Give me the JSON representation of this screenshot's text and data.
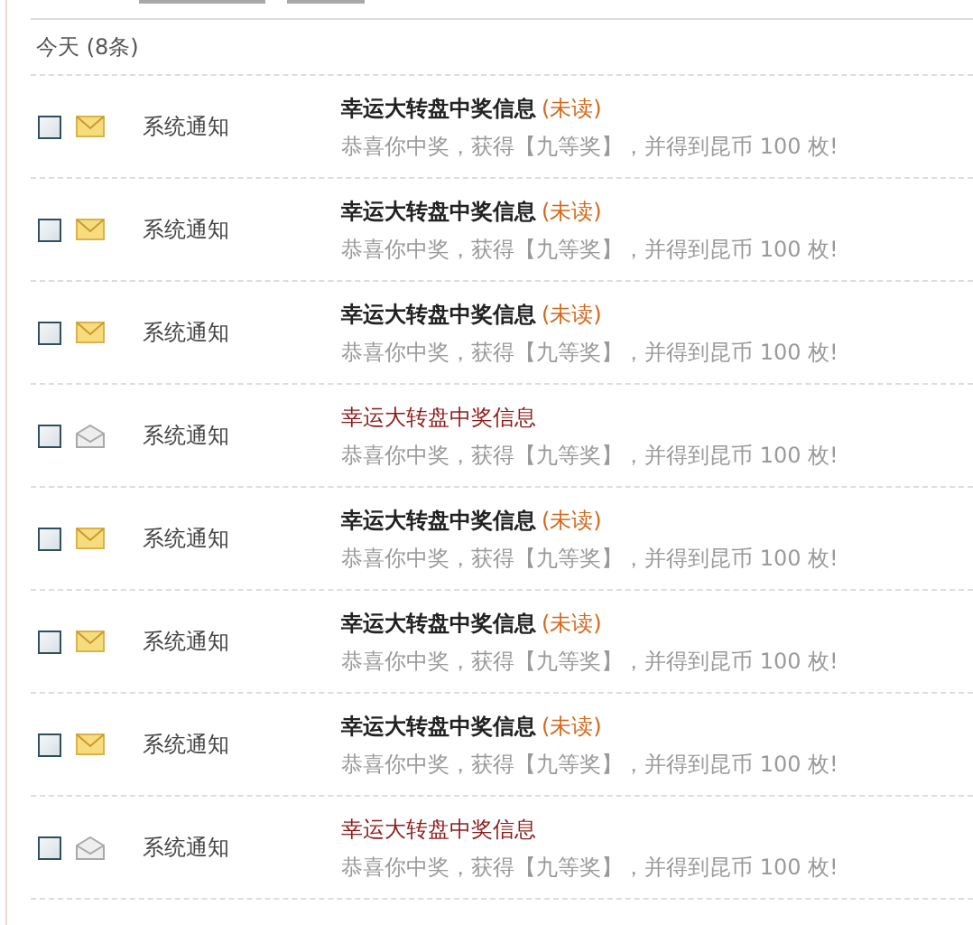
{
  "section": {
    "title": "今天 (8条)"
  },
  "messages": [
    {
      "checked": false,
      "unread": true,
      "sender": "系统通知",
      "title": "幸运大转盘中奖信息",
      "badge": "(未读)",
      "body": "恭喜你中奖，获得【九等奖】，并得到昆币 100 枚!"
    },
    {
      "checked": false,
      "unread": true,
      "sender": "系统通知",
      "title": "幸运大转盘中奖信息",
      "badge": "(未读)",
      "body": "恭喜你中奖，获得【九等奖】，并得到昆币 100 枚!"
    },
    {
      "checked": false,
      "unread": true,
      "sender": "系统通知",
      "title": "幸运大转盘中奖信息",
      "badge": "(未读)",
      "body": "恭喜你中奖，获得【九等奖】，并得到昆币 100 枚!"
    },
    {
      "checked": false,
      "unread": false,
      "sender": "系统通知",
      "title": "幸运大转盘中奖信息",
      "body": "恭喜你中奖，获得【九等奖】，并得到昆币 100 枚!"
    },
    {
      "checked": false,
      "unread": true,
      "sender": "系统通知",
      "title": "幸运大转盘中奖信息",
      "badge": "(未读)",
      "body": "恭喜你中奖，获得【九等奖】，并得到昆币 100 枚!"
    },
    {
      "checked": false,
      "unread": true,
      "sender": "系统通知",
      "title": "幸运大转盘中奖信息",
      "badge": "(未读)",
      "body": "恭喜你中奖，获得【九等奖】，并得到昆币 100 枚!"
    },
    {
      "checked": false,
      "unread": true,
      "sender": "系统通知",
      "title": "幸运大转盘中奖信息",
      "badge": "(未读)",
      "body": "恭喜你中奖，获得【九等奖】，并得到昆币 100 枚!"
    },
    {
      "checked": false,
      "unread": false,
      "sender": "系统通知",
      "title": "幸运大转盘中奖信息",
      "body": "恭喜你中奖，获得【九等奖】，并得到昆币 100 枚!"
    }
  ]
}
